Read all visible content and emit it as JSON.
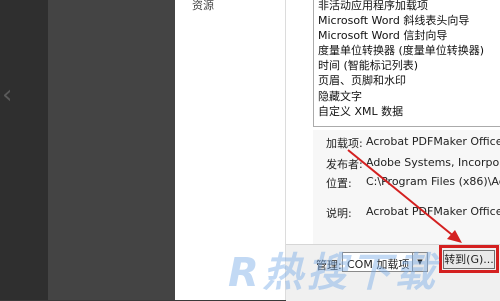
{
  "sidebar": {
    "items": [
      "资源"
    ]
  },
  "addins_list": {
    "items": [
      "非活动应用程序加载项",
      "Microsoft Word 斜线表头向导",
      "Microsoft Word 信封向导",
      "度量单位转换器 (度量单位转换器)",
      "时间 (智能标记列表)",
      "页眉、页脚和水印",
      "隐藏文字",
      "自定义 XML 数据"
    ]
  },
  "details": {
    "addin_label": "加载项:",
    "addin_value": "Acrobat PDFMaker Office CO",
    "publisher_label": "发布者:",
    "publisher_value": "Adobe Systems, Incorporate",
    "location_label": "位置:",
    "location_value": "C:\\Program Files (x86)\\Adob",
    "description_label": "说明:",
    "description_value": "Acrobat PDFMaker Office CO"
  },
  "manage": {
    "label": "管理:",
    "selected": "COM 加载项",
    "go_label": "转到(G)..."
  },
  "watermark": {
    "text": "R热搜下载"
  },
  "colors": {
    "highlight": "#d42020",
    "watermark": "#78aae6"
  }
}
